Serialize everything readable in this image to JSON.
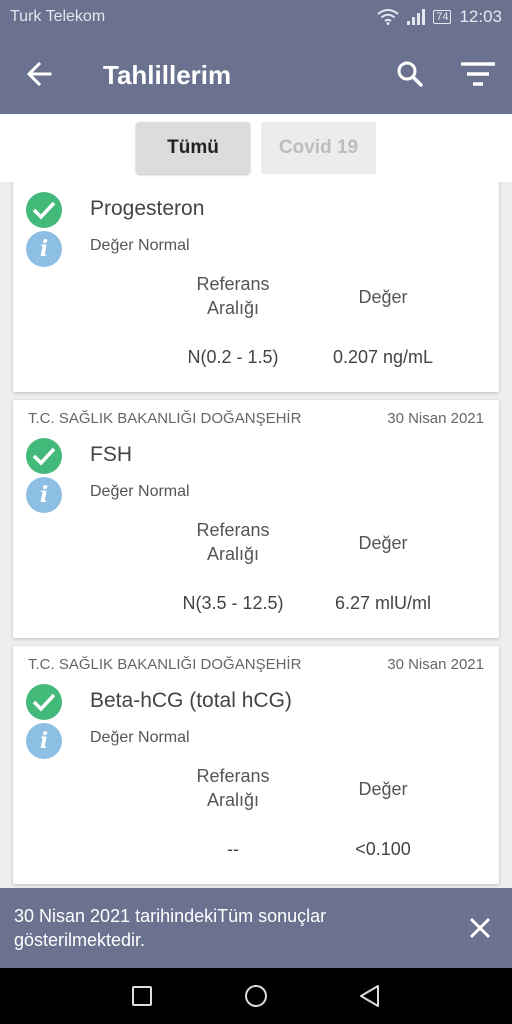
{
  "status_bar": {
    "carrier": "Turk Telekom",
    "battery": "74",
    "time": "12:03"
  },
  "app_bar": {
    "title": "Tahlillerim",
    "icons": [
      "back-arrow-icon",
      "search-icon",
      "filter-icon"
    ]
  },
  "tabs": [
    {
      "label": "Tümü",
      "active": true
    },
    {
      "label": "Covid 19",
      "active": false
    }
  ],
  "labels": {
    "ref_range": "Referans Aralığı",
    "value": "Değer"
  },
  "results": [
    {
      "institution": "",
      "date": "",
      "test": "Progesteron",
      "status": "Değer Normal",
      "ref_range": "N(0.2 - 1.5)",
      "value": "0.207 ng/mL"
    },
    {
      "institution": "T.C. SAĞLIK BAKANLIĞI DOĞANŞEHİR",
      "date": "30 Nisan 2021",
      "test": "FSH",
      "status": "Değer Normal",
      "ref_range": "N(3.5 - 12.5)",
      "value": "6.27 mlU/ml"
    },
    {
      "institution": "T.C. SAĞLIK BAKANLIĞI DOĞANŞEHİR",
      "date": "30 Nisan 2021",
      "test": "Beta-hCG (total hCG)",
      "status": "Değer Normal",
      "ref_range": "--",
      "value": "<0.100"
    }
  ],
  "snackbar": {
    "message": "30 Nisan 2021 tarihindekiTüm sonuçlar gösterilmektedir."
  },
  "colors": {
    "primary": "#6a7290",
    "check_green": "#43b97a",
    "info_blue": "#8cbfe3"
  }
}
